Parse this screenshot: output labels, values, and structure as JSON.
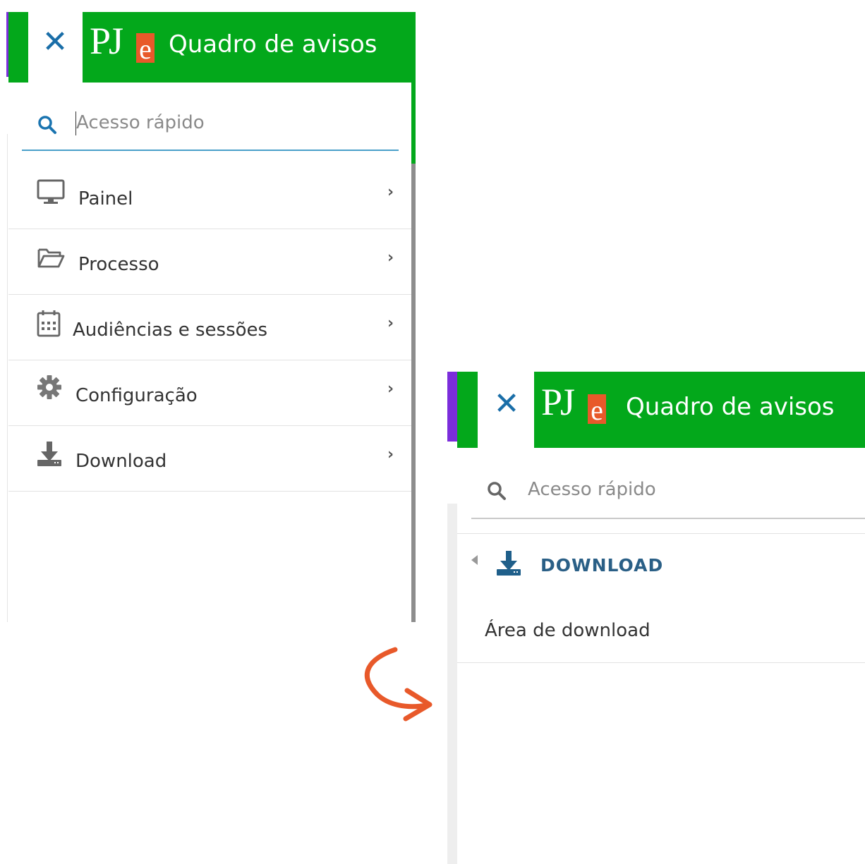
{
  "colors": {
    "header_green": "#03a81b",
    "accent_purple": "#7b2ddb",
    "logo_orange": "#e8592a",
    "close_blue": "#1a6ea8",
    "arrow_orange": "#e8592a"
  },
  "panel_menu": {
    "header": {
      "close_icon": "close-icon",
      "logo_text": "PJ",
      "logo_badge": "e",
      "title": "Quadro de avisos"
    },
    "search": {
      "icon": "search-icon",
      "placeholder": "Acesso rápido"
    },
    "items": [
      {
        "label": "Painel",
        "icon": "monitor-icon"
      },
      {
        "label": "Processo",
        "icon": "folder-open-icon"
      },
      {
        "label": "Audiências e sessões",
        "icon": "calendar-icon"
      },
      {
        "label": "Configuração",
        "icon": "gear-icon"
      },
      {
        "label": "Download",
        "icon": "download-icon"
      }
    ]
  },
  "panel_download": {
    "header": {
      "close_icon": "close-icon",
      "logo_text": "PJ",
      "logo_badge": "e",
      "title": "Quadro de avisos"
    },
    "search": {
      "icon": "search-icon",
      "placeholder": "Acesso rápido"
    },
    "section": {
      "back_icon": "caret-left-icon",
      "icon": "download-icon",
      "title": "DOWNLOAD"
    },
    "items": [
      {
        "label": "Área de download"
      }
    ]
  },
  "transition_arrow": "curved-arrow-icon"
}
